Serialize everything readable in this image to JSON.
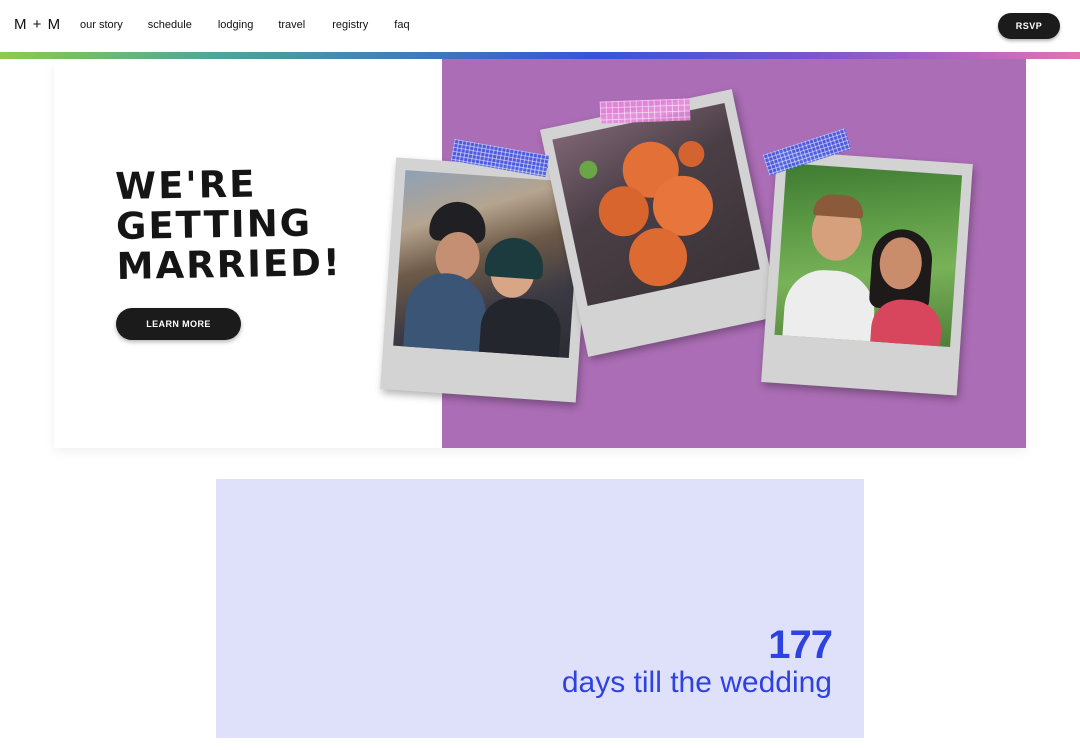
{
  "header": {
    "brand": "M + M",
    "nav": [
      "our story",
      "schedule",
      "lodging",
      "travel",
      "registry",
      "faq"
    ],
    "rsvp_label": "RSVP"
  },
  "hero": {
    "title_lines": [
      "WE'RE",
      "GETTING",
      "MARRIED!"
    ],
    "learn_more_label": "LEARN MORE"
  },
  "countdown": {
    "days": "177",
    "label": "days till the wedding"
  },
  "colors": {
    "purple_panel": "#ab6db5",
    "countdown_bg": "#dfe1fb",
    "countdown_text": "#2e42e0",
    "button_dark": "#1b1b1b"
  },
  "icons": [
    "photo-polaroid",
    "washi-tape"
  ]
}
